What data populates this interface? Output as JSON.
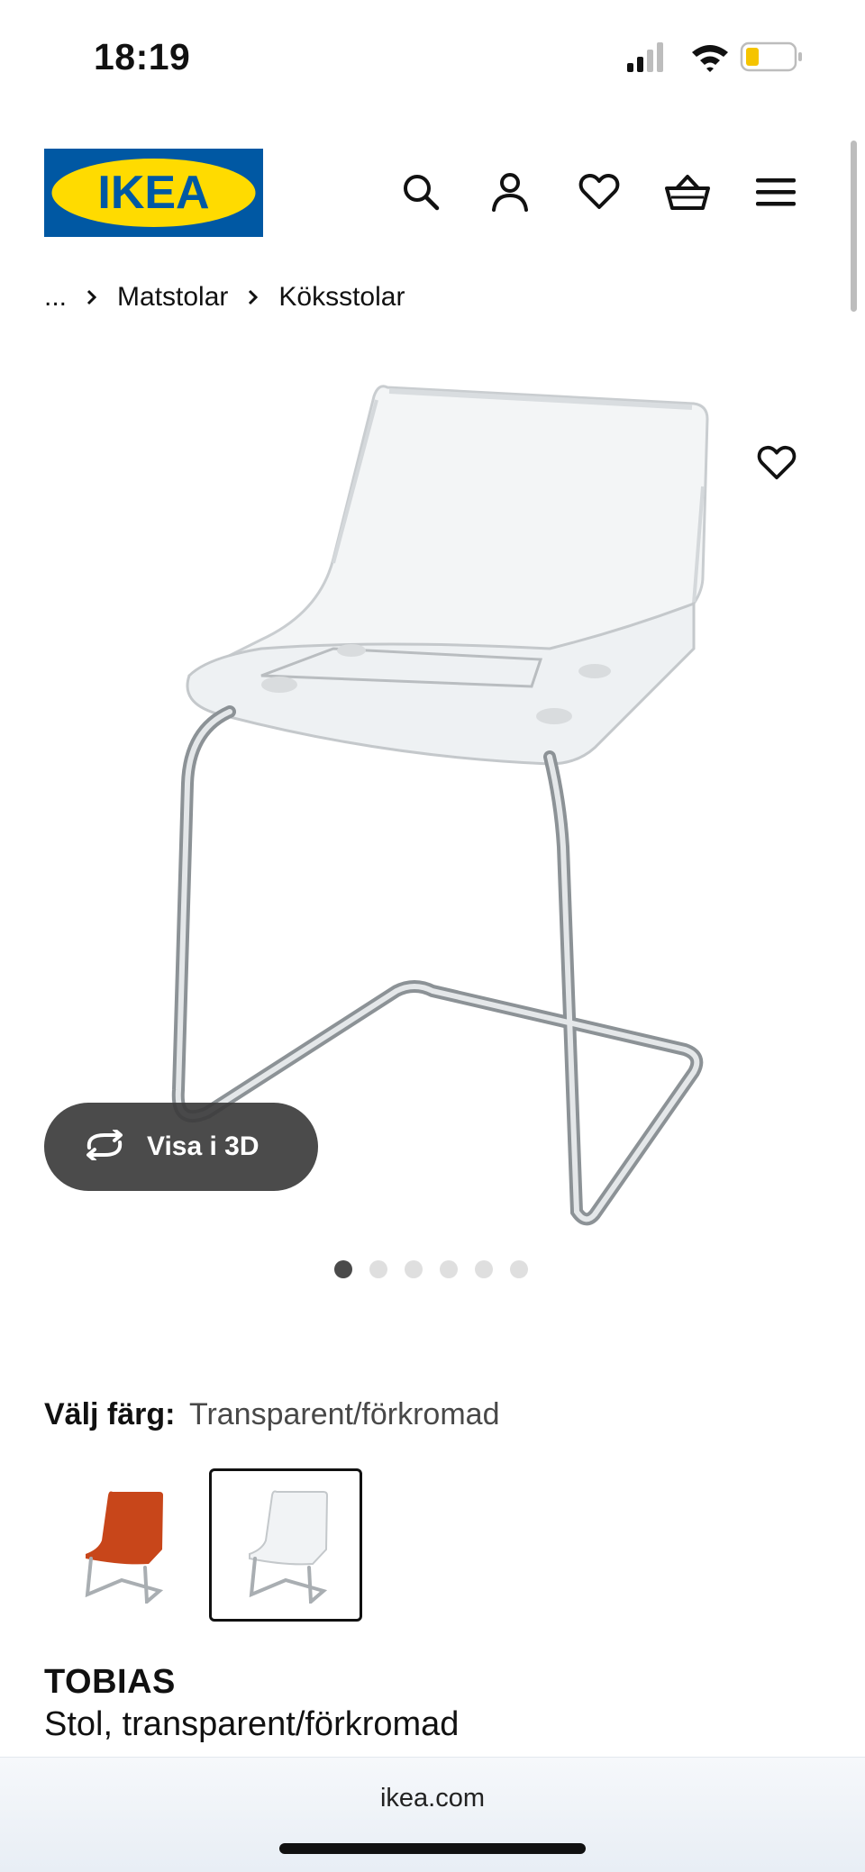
{
  "status_bar": {
    "time": "18:19",
    "icons": [
      "cellular-signal-icon",
      "wifi-icon",
      "battery-low-icon"
    ]
  },
  "header": {
    "logo_text": "IKEA",
    "brand_colors": {
      "blue": "#0058a3",
      "yellow": "#ffdb00"
    },
    "icons": [
      "search-icon",
      "profile-icon",
      "heart-icon",
      "shopping-basket-icon",
      "menu-icon"
    ]
  },
  "breadcrumb": {
    "items": [
      "...",
      "Matstolar",
      "Köksstolar"
    ]
  },
  "gallery": {
    "visa_3d_label": "Visa i 3D",
    "dot_count": 6,
    "active_dot": 1
  },
  "color_selection": {
    "label": "Välj färg:",
    "value": "Transparent/förkromad",
    "swatches": [
      {
        "name": "orange",
        "color": "#c8461a",
        "selected": false
      },
      {
        "name": "transparent",
        "color": "#e9eef1",
        "selected": true
      }
    ]
  },
  "product": {
    "name": "TOBIAS",
    "description": "Stol, transparent/förkromad"
  },
  "browser": {
    "url": "ikea.com"
  }
}
